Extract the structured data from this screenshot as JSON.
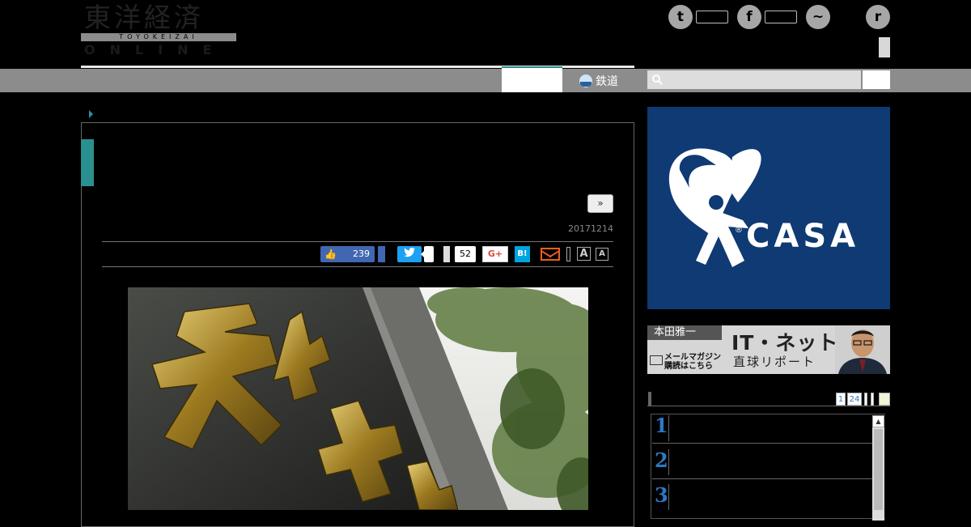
{
  "header": {
    "logo_kanji": "東洋経済",
    "logo_band": "TOYOKEIZAI",
    "logo_online": "ONLINE",
    "social": [
      {
        "name": "twitter",
        "glyph": "t"
      },
      {
        "name": "facebook",
        "glyph": "f"
      },
      {
        "name": "messenger",
        "glyph": "~"
      },
      {
        "name": "rss",
        "glyph": "r"
      }
    ]
  },
  "nav": {
    "rail_label": "鉄道",
    "search_placeholder": ""
  },
  "article": {
    "next_label": "»",
    "date": "20171214",
    "share": {
      "like_count": "239",
      "share_count": "52",
      "gplus_label": "G+",
      "hatena_label": "B!",
      "font_large": "A",
      "font_small": "A"
    }
  },
  "sidebar": {
    "ad_brand": "CASA",
    "banner": {
      "name": "本田雅一",
      "title": "IT・ネット",
      "subtitle": "直球リポート",
      "mail_line1": "メールマガジン",
      "mail_line2": "購読はこちら"
    },
    "ranking": {
      "tabs": [
        "1",
        "24"
      ],
      "items": [
        "1",
        "2",
        "3"
      ]
    }
  },
  "colors": {
    "accent_teal": "#2a8f8f",
    "nav_gray": "#8c8c8c",
    "facebook_blue": "#4267b2",
    "twitter_blue": "#1da1f2",
    "casa_navy": "#0f3a73"
  }
}
